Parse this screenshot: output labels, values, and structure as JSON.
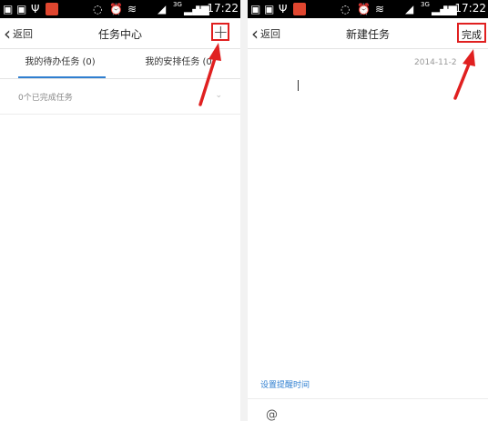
{
  "status_bar": {
    "time": "17:22",
    "network": "3G",
    "icons": [
      "image-icon",
      "image-icon",
      "usb-icon",
      "app-badge-icon",
      "data-icon",
      "alarm-icon",
      "wifi-icon",
      "signal-icon",
      "battery-icon"
    ]
  },
  "left_screen": {
    "back_label": "返回",
    "title": "任务中心",
    "add_button_symbol": "+",
    "tabs": [
      {
        "label": "我的待办任务 (0)",
        "active": true
      },
      {
        "label": "我的安排任务 (0)",
        "active": false
      }
    ],
    "completed_text": "0个已完成任务",
    "completed_icon": "chevron-down-icon"
  },
  "right_screen": {
    "back_label": "返回",
    "title": "新建任务",
    "done_label": "完成",
    "date": "2014-11-2",
    "reminder_link": "设置提醒时间",
    "mention_symbol": "@"
  },
  "colors": {
    "accent_blue": "#2f7fd0",
    "highlight_red": "#e02020",
    "status_bar": "#000000"
  }
}
